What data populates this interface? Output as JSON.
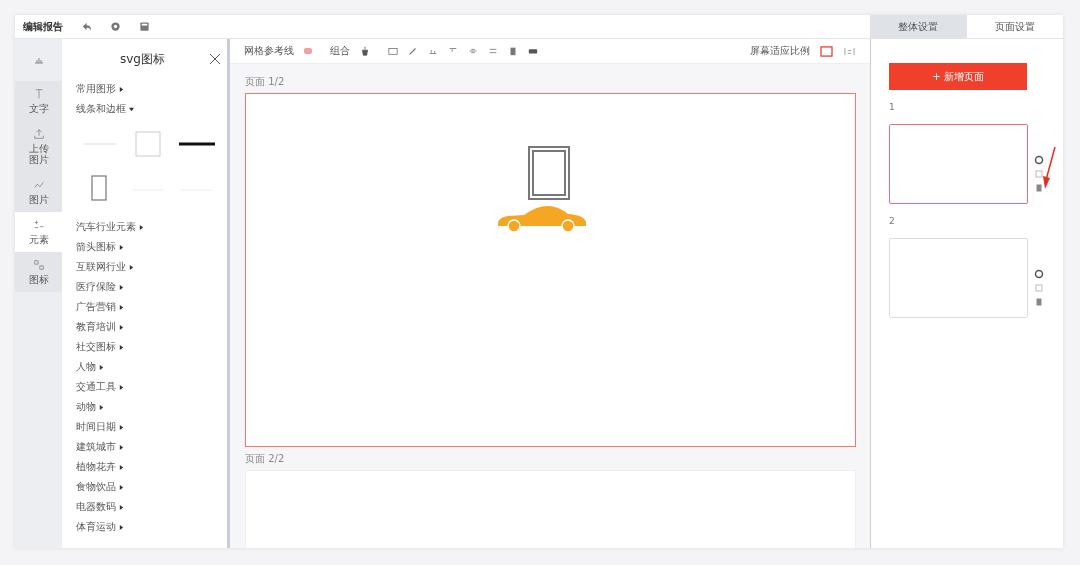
{
  "header": {
    "title": "编辑报告"
  },
  "right_tabs": [
    {
      "label": "整体设置",
      "selected": false
    },
    {
      "label": "页面设置",
      "selected": true
    }
  ],
  "rail": [
    {
      "label": "文字",
      "selected": false,
      "kind": "text"
    },
    {
      "label": "上传图片",
      "selected": false,
      "kind": "upload"
    },
    {
      "label": "图片",
      "selected": false,
      "kind": "image"
    },
    {
      "label": "元素",
      "selected": true,
      "kind": "element"
    },
    {
      "label": "图标",
      "selected": false,
      "kind": "icon"
    }
  ],
  "panel": {
    "title": "svg图标",
    "categories": [
      {
        "label": "常用图形",
        "expanded": false
      },
      {
        "label": "线条和边框",
        "expanded": true,
        "shapes": [
          {
            "kind": "line-thin"
          },
          {
            "kind": "square"
          },
          {
            "kind": "line-thick"
          },
          {
            "kind": "portrait"
          },
          {
            "kind": "line-faint"
          },
          {
            "kind": "line-faint"
          }
        ]
      },
      {
        "label": "汽车行业元素",
        "expanded": false
      },
      {
        "label": "箭头图标",
        "expanded": false
      },
      {
        "label": "互联网行业",
        "expanded": false
      },
      {
        "label": "医疗保险",
        "expanded": false
      },
      {
        "label": "广告营销",
        "expanded": false
      },
      {
        "label": "教育培训",
        "expanded": false
      },
      {
        "label": "社交图标",
        "expanded": false
      },
      {
        "label": "人物",
        "expanded": false
      },
      {
        "label": "交通工具",
        "expanded": false
      },
      {
        "label": "动物",
        "expanded": false
      },
      {
        "label": "时间日期",
        "expanded": false
      },
      {
        "label": "建筑城市",
        "expanded": false
      },
      {
        "label": "植物花卉",
        "expanded": false
      },
      {
        "label": "食物饮品",
        "expanded": false
      },
      {
        "label": "电器数码",
        "expanded": false
      },
      {
        "label": "体育运动",
        "expanded": false
      }
    ]
  },
  "toolbar": {
    "grid_label": "网格参考线",
    "grid_on": true,
    "group_label": "组合",
    "zoom_label": "屏幕适应比例"
  },
  "pages": [
    {
      "label": "页面 1/2",
      "selected": true
    },
    {
      "label": "页面 2/2",
      "selected": false
    }
  ],
  "add_page_button": "+ 新增页面",
  "thumbnails": [
    {
      "number": "1",
      "selected": true
    },
    {
      "number": "2",
      "selected": false
    }
  ]
}
